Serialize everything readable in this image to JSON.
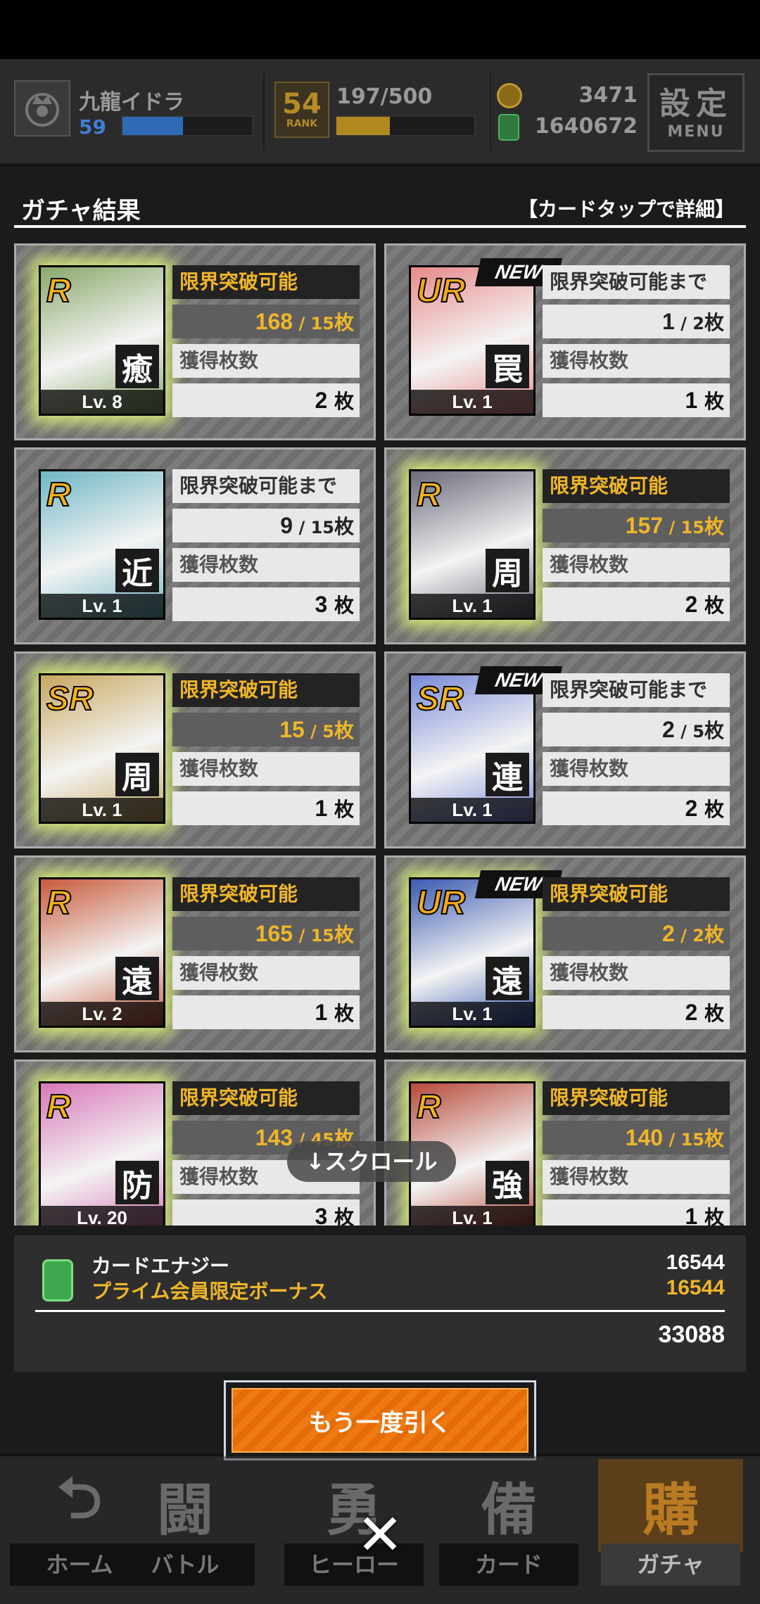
{
  "header": {
    "player_name": "九龍イドラ",
    "player_level": "59",
    "xp_fill_fraction": 0.47,
    "rank_number": "54",
    "rank_label": "RANK",
    "rank_progress": "197/500",
    "rank_fill_fraction": 0.39,
    "coins": "3471",
    "energy": "1640672",
    "settings_label": "設定",
    "settings_sub": "MENU"
  },
  "section": {
    "title": "ガチャ結果",
    "hint": "【カードタップで詳細】"
  },
  "labels": {
    "obtained": "獲得枚数",
    "unit": "枚",
    "new_tag": "NEW",
    "scroll": "↓スクロール"
  },
  "cards": [
    {
      "rarity": "R",
      "role": "癒",
      "level": "Lv. 8",
      "status": "限界突破可能",
      "owned": "168",
      "needed": "15",
      "count": "2",
      "is_new": false,
      "breakable": true,
      "art_color": "#8aa86a"
    },
    {
      "rarity": "UR",
      "role": "罠",
      "level": "Lv. 1",
      "status": "限界突破可能まで",
      "owned": "1",
      "needed": "2",
      "count": "1",
      "is_new": true,
      "breakable": false,
      "art_color": "#e88a8a"
    },
    {
      "rarity": "R",
      "role": "近",
      "level": "Lv. 1",
      "status": "限界突破可能まで",
      "owned": "9",
      "needed": "15",
      "count": "3",
      "is_new": false,
      "breakable": false,
      "art_color": "#6fb7c4"
    },
    {
      "rarity": "R",
      "role": "周",
      "level": "Lv. 1",
      "status": "限界突破可能",
      "owned": "157",
      "needed": "15",
      "count": "2",
      "is_new": false,
      "breakable": true,
      "art_color": "#6a6a7a"
    },
    {
      "rarity": "SR",
      "role": "周",
      "level": "Lv. 1",
      "status": "限界突破可能",
      "owned": "15",
      "needed": "5",
      "count": "1",
      "is_new": false,
      "breakable": true,
      "art_color": "#c8a860"
    },
    {
      "rarity": "SR",
      "role": "連",
      "level": "Lv. 1",
      "status": "限界突破可能まで",
      "owned": "2",
      "needed": "5",
      "count": "2",
      "is_new": true,
      "breakable": false,
      "art_color": "#7a8ad8"
    },
    {
      "rarity": "R",
      "role": "遠",
      "level": "Lv. 2",
      "status": "限界突破可能",
      "owned": "165",
      "needed": "15",
      "count": "1",
      "is_new": false,
      "breakable": true,
      "art_color": "#c85a3a"
    },
    {
      "rarity": "UR",
      "role": "遠",
      "level": "Lv. 1",
      "status": "限界突破可能",
      "owned": "2",
      "needed": "2",
      "count": "2",
      "is_new": true,
      "breakable": true,
      "art_color": "#3a5ab0"
    },
    {
      "rarity": "R",
      "role": "防",
      "level": "Lv. 20",
      "status": "限界突破可能",
      "owned": "143",
      "needed": "45",
      "count": "3",
      "is_new": false,
      "breakable": true,
      "art_color": "#d878b8"
    },
    {
      "rarity": "R",
      "role": "強",
      "level": "Lv. 1",
      "status": "限界突破可能",
      "owned": "140",
      "needed": "15",
      "count": "1",
      "is_new": false,
      "breakable": true,
      "art_color": "#b84a3a"
    }
  ],
  "energy_panel": {
    "label": "カードエナジー",
    "bonus_label": "プライム会員限定ボーナス",
    "value": "16544",
    "bonus_value": "16544",
    "total": "33088"
  },
  "again_button": "もう一度引く",
  "nav": [
    {
      "label": "ホーム",
      "icon": "home-icon",
      "glyph": "⮌",
      "active": false
    },
    {
      "label": "バトル",
      "icon": "battle-icon",
      "glyph": "闘",
      "active": false
    },
    {
      "label": "ヒーロー",
      "icon": "hero-icon",
      "glyph": "勇",
      "active": false
    },
    {
      "label": "カード",
      "icon": "card-icon",
      "glyph": "備",
      "active": false
    },
    {
      "label": "ガチャ",
      "icon": "gacha-icon",
      "glyph": "購",
      "active": true
    }
  ],
  "close_glyph": "✕"
}
